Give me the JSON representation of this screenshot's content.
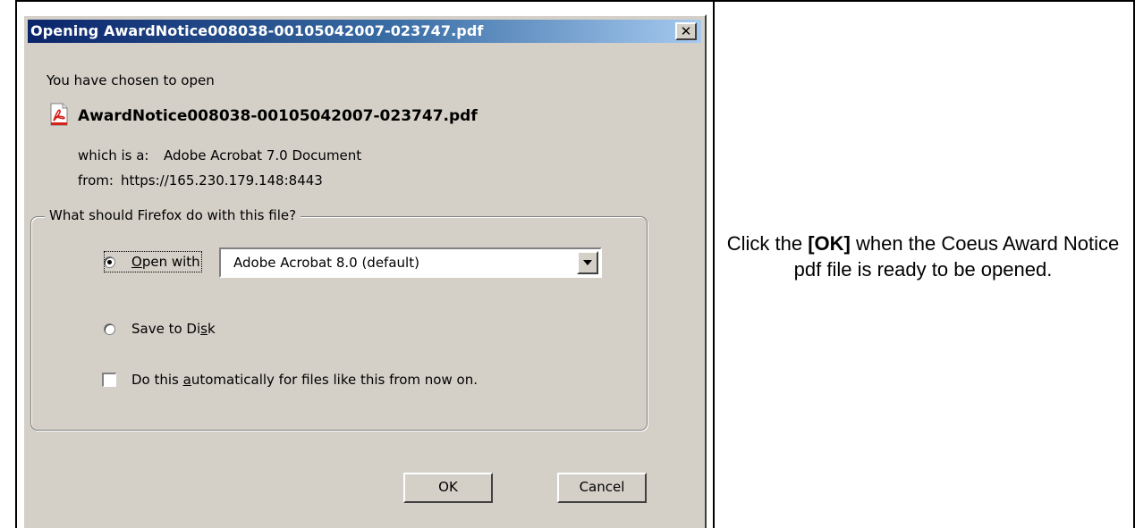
{
  "dialog": {
    "title": "Opening AwardNotice008038-00105042007-023747.pdf",
    "close_label": "✕",
    "intro": "You have chosen to open",
    "filename": "AwardNotice008038-00105042007-023747.pdf",
    "type_label": "which is a:",
    "type_value": "Adobe Acrobat 7.0 Document",
    "from_label": "from:",
    "from_value": "https://165.230.179.148:8443",
    "group_label": "What should Firefox do with this file?",
    "open_with": {
      "label_accel": "O",
      "label_rest": "pen with",
      "selected": true,
      "app_selected": "Adobe Acrobat 8.0 (default)"
    },
    "save_to_disk": {
      "label_before": "Save to Di",
      "label_accel": "s",
      "label_after": "k",
      "selected": false
    },
    "auto_checkbox": {
      "label_before": "Do this ",
      "label_accel": "a",
      "label_after": "utomatically for files like this from now on.",
      "checked": false
    },
    "ok_label": "OK",
    "cancel_label": "Cancel"
  },
  "instruction": {
    "part1": "Click the ",
    "bold": "[OK]",
    "part2": " when the Coeus Award Notice pdf file is ready to be opened."
  },
  "colors": {
    "dialog_bg": "#d4d0c8",
    "titlebar_start": "#0a246a",
    "titlebar_end": "#a6caf0",
    "pdf_icon_red": "#d8201a"
  }
}
